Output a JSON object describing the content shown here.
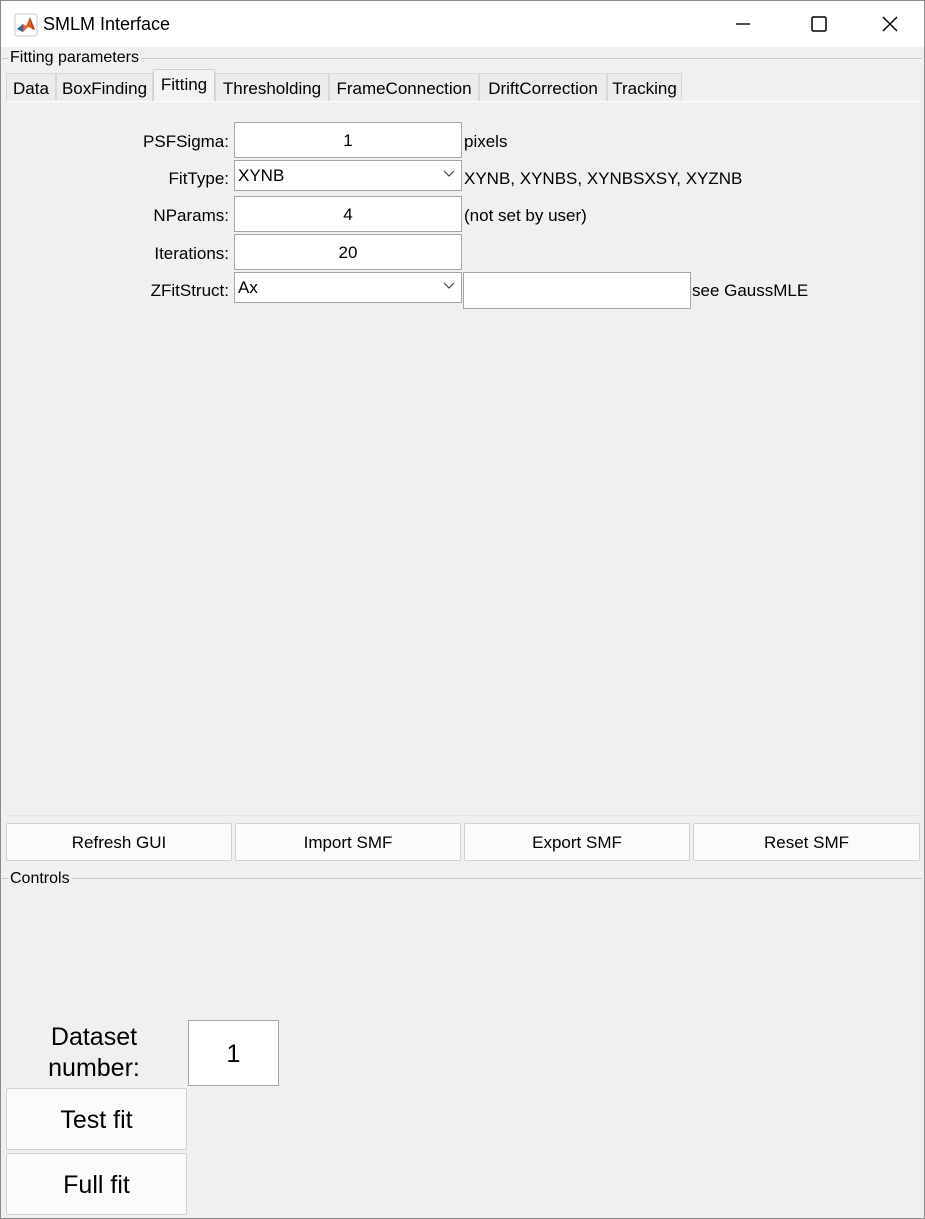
{
  "window": {
    "title": "SMLM Interface",
    "icon": "matlab-icon",
    "controls": [
      "minimize-icon",
      "maximize-icon",
      "close-icon"
    ]
  },
  "fitting_group": {
    "label": "Fitting parameters",
    "tabs": [
      {
        "label": "Data",
        "active": false
      },
      {
        "label": "BoxFinding",
        "active": false
      },
      {
        "label": "Fitting",
        "active": true
      },
      {
        "label": "Thresholding",
        "active": false
      },
      {
        "label": "FrameConnection",
        "active": false
      },
      {
        "label": "DriftCorrection",
        "active": false
      },
      {
        "label": "Tracking",
        "active": false
      }
    ],
    "params": {
      "psf_sigma": {
        "label": "PSFSigma:",
        "value": "1",
        "hint": "pixels"
      },
      "fit_type": {
        "label": "FitType:",
        "value": "XYNB",
        "hint": "XYNB, XYNBS, XYNBSXSY, XYZNB"
      },
      "nparams": {
        "label": "NParams:",
        "value": "4",
        "hint": "(not set by user)"
      },
      "iterations": {
        "label": "Iterations:",
        "value": "20"
      },
      "zfit_struct": {
        "label": "ZFitStruct:",
        "value": "Ax",
        "extra_value": "",
        "hint": "see GaussMLE"
      }
    },
    "buttons": {
      "refresh": "Refresh GUI",
      "import": "Import SMF",
      "export": "Export SMF",
      "reset": "Reset SMF"
    }
  },
  "controls_group": {
    "label": "Controls",
    "dataset_label_line1": "Dataset",
    "dataset_label_line2": "number:",
    "dataset_value": "1",
    "test_fit": "Test fit",
    "full_fit": "Full fit"
  }
}
